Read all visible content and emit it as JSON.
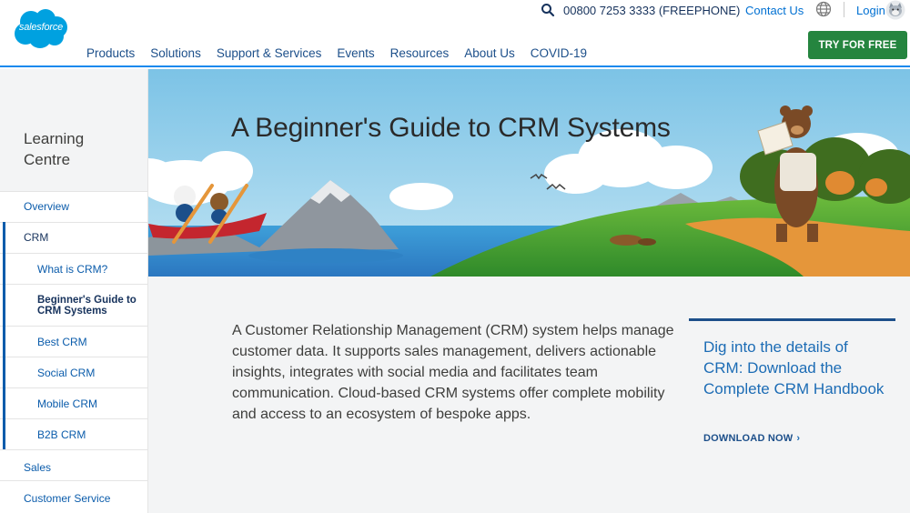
{
  "brand": {
    "logo_text": "salesforce",
    "color": "#00a1e0"
  },
  "utility": {
    "phone": "00800 7253 3333 (FREEPHONE)",
    "contact": "Contact Us",
    "login": "Login"
  },
  "nav": {
    "items": [
      "Products",
      "Solutions",
      "Support & Services",
      "Events",
      "Resources",
      "About Us",
      "COVID-19"
    ],
    "cta": "TRY FOR FREE"
  },
  "sidebar": {
    "title": "Learning Centre",
    "items": [
      {
        "label": "Overview"
      },
      {
        "label": "CRM"
      },
      {
        "label": "What is CRM?"
      },
      {
        "label": "Beginner's Guide to CRM Systems"
      },
      {
        "label": "Best CRM"
      },
      {
        "label": "Social CRM"
      },
      {
        "label": "Mobile CRM"
      },
      {
        "label": "B2B CRM"
      },
      {
        "label": "Sales"
      },
      {
        "label": "Customer Service"
      }
    ]
  },
  "hero": {
    "title": "A Beginner's Guide to CRM Systems"
  },
  "main": {
    "intro": "A Customer Relationship Management (CRM) system helps manage customer data. It supports sales management, delivers actionable insights, integrates with social media and facilitates team communication. Cloud-based CRM systems offer complete mobility and access to an ecosystem of bespoke apps."
  },
  "promo": {
    "title": "Dig into the details of CRM: Download the Complete CRM Handbook",
    "cta": "DOWNLOAD NOW"
  },
  "icons": [
    "search-icon",
    "globe-icon",
    "avatar-icon",
    "chevron-right-icon"
  ],
  "colors": {
    "accent": "#0070d2",
    "cta_green": "#25853f",
    "nav_rule": "#1589ee"
  }
}
